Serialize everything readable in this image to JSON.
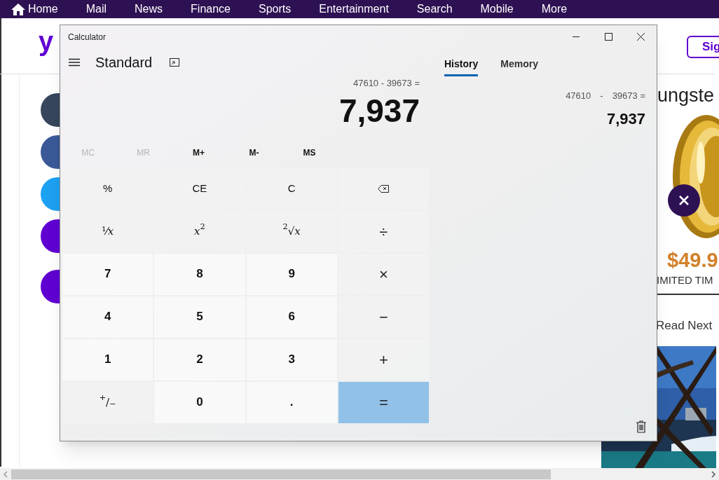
{
  "nav": [
    {
      "label": "Home",
      "kind": "home"
    },
    {
      "label": "Mail"
    },
    {
      "label": "News"
    },
    {
      "label": "Finance"
    },
    {
      "label": "Sports"
    },
    {
      "label": "Entertainment"
    },
    {
      "label": "Search"
    },
    {
      "label": "Mobile"
    },
    {
      "label": "More"
    }
  ],
  "logo": "y",
  "sign_in": "Sig",
  "share_buttons": [
    {
      "color": "#36465d"
    },
    {
      "color": "#3b5998"
    },
    {
      "color": "#1da1f2"
    },
    {
      "color": "#6001d2"
    },
    {
      "color": "#6001d2"
    }
  ],
  "ad": {
    "title": "ungste",
    "price": "$49.9",
    "note": "IMITED TIM"
  },
  "read_next": "Read Next",
  "calculator": {
    "title": "Calculator",
    "mode": "Standard",
    "expression": "47610 - 39673 =",
    "display": "7,937",
    "memory": [
      {
        "label": "MC",
        "disabled": true
      },
      {
        "label": "MR",
        "disabled": true
      },
      {
        "label": "M+",
        "disabled": false
      },
      {
        "label": "M-",
        "disabled": false
      },
      {
        "label": "MS",
        "disabled": false
      }
    ],
    "keys": [
      {
        "label": "%",
        "kind": "function"
      },
      {
        "label": "CE",
        "kind": "function"
      },
      {
        "label": "C",
        "kind": "function"
      },
      {
        "kind": "backspace"
      },
      {
        "label": "¹⁄*x*",
        "kind": "function"
      },
      {
        "label": "*x*$^{2}$",
        "kind": "function"
      },
      {
        "label": "$^{2}$√*x*",
        "kind": "function"
      },
      {
        "label": "÷",
        "kind": "operator"
      },
      {
        "label": "7",
        "kind": "digit"
      },
      {
        "label": "8",
        "kind": "digit"
      },
      {
        "label": "9",
        "kind": "digit"
      },
      {
        "label": "×",
        "kind": "operator"
      },
      {
        "label": "4",
        "kind": "digit"
      },
      {
        "label": "5",
        "kind": "digit"
      },
      {
        "label": "6",
        "kind": "digit"
      },
      {
        "label": "−",
        "kind": "operator"
      },
      {
        "label": "1",
        "kind": "digit"
      },
      {
        "label": "2",
        "kind": "digit"
      },
      {
        "label": "3",
        "kind": "digit"
      },
      {
        "label": "+",
        "kind": "operator"
      },
      {
        "label": "$^{+}$/$_{−}$",
        "kind": "function"
      },
      {
        "label": "0",
        "kind": "digit"
      },
      {
        "label": ".",
        "kind": "digit"
      },
      {
        "label": "=",
        "kind": "equals"
      }
    ],
    "tabs": [
      {
        "label": "History",
        "selected": true
      },
      {
        "label": "Memory",
        "selected": false
      }
    ],
    "history": [
      {
        "expression": [
          "47610",
          "-",
          "39673 ="
        ],
        "result": "7,937"
      }
    ]
  }
}
